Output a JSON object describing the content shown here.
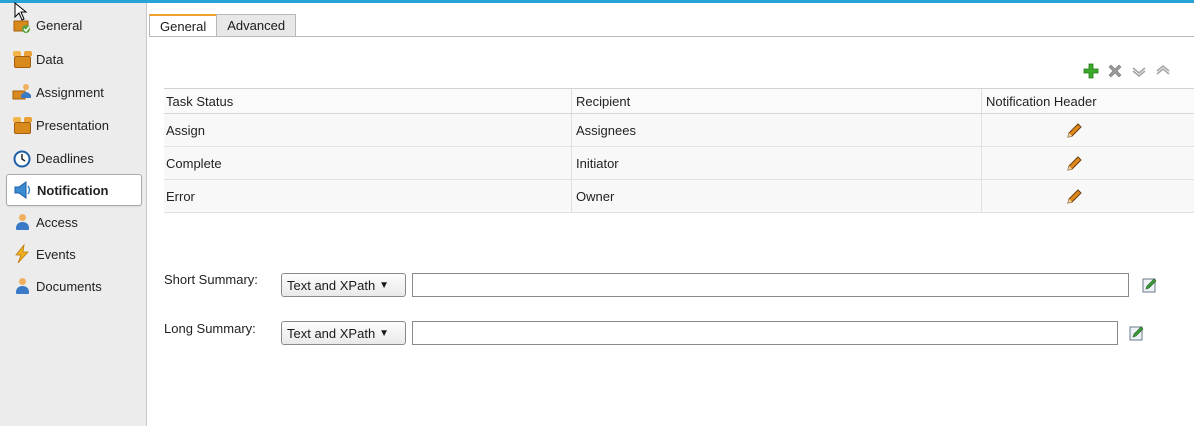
{
  "sidebar": {
    "items": [
      {
        "label": "General",
        "icon": "general-icon"
      },
      {
        "label": "Data",
        "icon": "data-box-icon"
      },
      {
        "label": "Assignment",
        "icon": "assignment-icon"
      },
      {
        "label": "Presentation",
        "icon": "presentation-icon"
      },
      {
        "label": "Deadlines",
        "icon": "deadlines-clock-icon"
      },
      {
        "label": "Notification",
        "icon": "notification-icon"
      },
      {
        "label": "Access",
        "icon": "access-icon"
      },
      {
        "label": "Events",
        "icon": "events-lightning-icon"
      },
      {
        "label": "Documents",
        "icon": "documents-icon"
      }
    ],
    "active": "Notification"
  },
  "tabs": [
    {
      "label": "General"
    },
    {
      "label": "Advanced"
    }
  ],
  "toolbar": {
    "add_icon": "plus-icon",
    "delete_icon": "delete-x-icon",
    "move_down_icon": "chevron-down-icon",
    "move_up_icon": "chevron-up-icon"
  },
  "table": {
    "headers": [
      "Task Status",
      "Recipient",
      "Notification Header"
    ],
    "rows": [
      {
        "status": "Assign",
        "recipient": "Assignees"
      },
      {
        "status": "Complete",
        "recipient": "Initiator"
      },
      {
        "status": "Error",
        "recipient": "Owner"
      }
    ]
  },
  "form": {
    "short_summary": {
      "label": "Short Summary:",
      "mode": "Text and XPath",
      "value": ""
    },
    "long_summary": {
      "label": "Long Summary:",
      "mode": "Text and XPath",
      "value": ""
    }
  },
  "colors": {
    "accent_top": "#29a3d6",
    "tab_active": "#f0a030",
    "add_green": "#3bab2a",
    "pencil_orange": "#e08a1e"
  }
}
